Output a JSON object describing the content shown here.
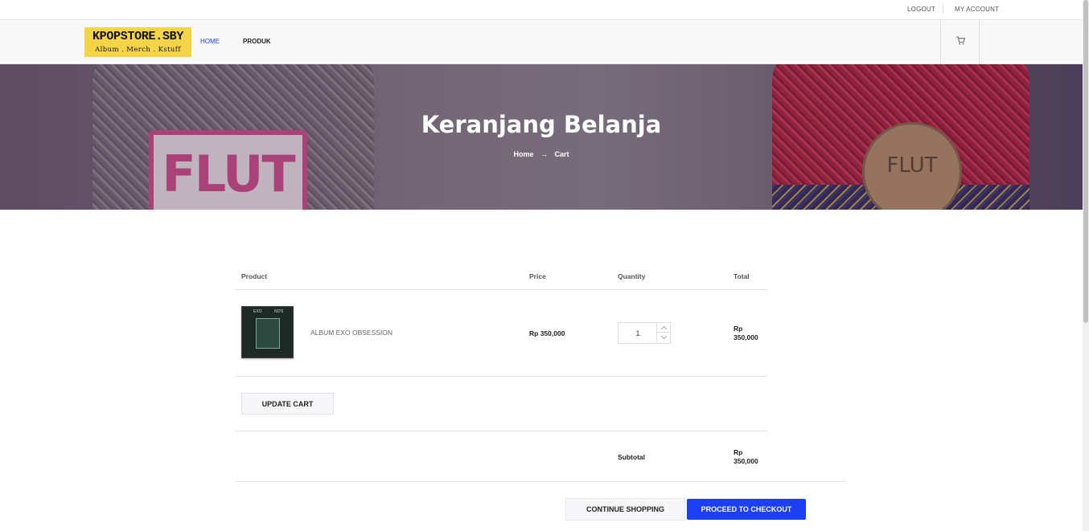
{
  "topbar": {
    "logout": "LOGOUT",
    "my_account": "MY ACCOUNT"
  },
  "header": {
    "logo_line1": "KPOPSTORE.SBY",
    "logo_line2": "Album . Merch . Kstuff",
    "nav": [
      {
        "label": "HOME",
        "active": true,
        "color": "#1c3ef5"
      },
      {
        "label": "PRODUK",
        "active": false,
        "color": "#222222"
      }
    ],
    "cart_icon": "cart-icon"
  },
  "hero": {
    "title": "Keranjang Belanja",
    "breadcrumb": {
      "home": "Home",
      "arrow": "→",
      "current": "Cart"
    },
    "image_text_left": "FLUT",
    "image_text_right": "FLUT"
  },
  "cart": {
    "columns": {
      "product": "Product",
      "price": "Price",
      "quantity": "Quantity",
      "total": "Total"
    },
    "items": [
      {
        "thumb_text_left": "EXO",
        "thumb_text_right": "NO'6",
        "name": "ALBUM EXO OBSESSION",
        "price": "Rp 350,000",
        "quantity": "1",
        "total_line1": "Rp",
        "total_line2": "350,000"
      }
    ],
    "update_button": "UPDATE CART",
    "subtotal_label": "Subtotal",
    "subtotal_line1": "Rp",
    "subtotal_line2": "350,000",
    "continue_button": "CONTINUE SHOPPING",
    "checkout_button": "PROCEED TO CHECKOUT"
  },
  "colors": {
    "accent": "#1c3ef5",
    "logo_bg": "#f5d547"
  }
}
